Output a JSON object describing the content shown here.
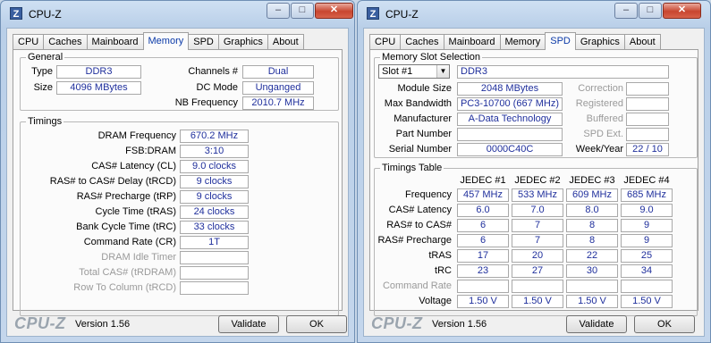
{
  "left_window": {
    "title": "CPU-Z",
    "icon_letter": "Z",
    "tabs": [
      "CPU",
      "Caches",
      "Mainboard",
      "Memory",
      "SPD",
      "Graphics",
      "About"
    ],
    "active_tab": "Memory",
    "general": {
      "label": "General",
      "type_label": "Type",
      "type_value": "DDR3",
      "size_label": "Size",
      "size_value": "4096 MBytes",
      "channels_label": "Channels #",
      "channels_value": "Dual",
      "dcmode_label": "DC Mode",
      "dcmode_value": "Unganged",
      "nbfreq_label": "NB Frequency",
      "nbfreq_value": "2010.7 MHz"
    },
    "timings": {
      "label": "Timings",
      "rows": [
        {
          "label": "DRAM Frequency",
          "value": "670.2 MHz"
        },
        {
          "label": "FSB:DRAM",
          "value": "3:10"
        },
        {
          "label": "CAS# Latency (CL)",
          "value": "9.0 clocks"
        },
        {
          "label": "RAS# to CAS# Delay (tRCD)",
          "value": "9 clocks"
        },
        {
          "label": "RAS# Precharge (tRP)",
          "value": "9 clocks"
        },
        {
          "label": "Cycle Time (tRAS)",
          "value": "24 clocks"
        },
        {
          "label": "Bank Cycle Time (tRC)",
          "value": "33 clocks"
        },
        {
          "label": "Command Rate (CR)",
          "value": "1T"
        },
        {
          "label": "DRAM Idle Timer",
          "value": ""
        },
        {
          "label": "Total CAS# (tRDRAM)",
          "value": ""
        },
        {
          "label": "Row To Column (tRCD)",
          "value": ""
        }
      ]
    },
    "footer": {
      "brand": "CPU-Z",
      "version": "Version 1.56",
      "validate": "Validate",
      "ok": "OK"
    }
  },
  "right_window": {
    "title": "CPU-Z",
    "icon_letter": "Z",
    "tabs": [
      "CPU",
      "Caches",
      "Mainboard",
      "Memory",
      "SPD",
      "Graphics",
      "About"
    ],
    "active_tab": "SPD",
    "slot": {
      "label": "Memory Slot Selection",
      "selected": "Slot #1",
      "type_value": "DDR3",
      "module_size_label": "Module Size",
      "module_size_value": "2048 MBytes",
      "max_bw_label": "Max Bandwidth",
      "max_bw_value": "PC3-10700 (667 MHz)",
      "manufacturer_label": "Manufacturer",
      "manufacturer_value": "A-Data Technology",
      "part_label": "Part Number",
      "part_value": "",
      "serial_label": "Serial Number",
      "serial_value": "0000C40C",
      "correction_label": "Correction",
      "correction_value": "",
      "registered_label": "Registered",
      "registered_value": "",
      "buffered_label": "Buffered",
      "buffered_value": "",
      "spd_ext_label": "SPD Ext.",
      "spd_ext_value": "",
      "weekyear_label": "Week/Year",
      "weekyear_value": "22 / 10"
    },
    "timings_table": {
      "label": "Timings Table",
      "columns": [
        "JEDEC #1",
        "JEDEC #2",
        "JEDEC #3",
        "JEDEC #4"
      ],
      "rows": [
        {
          "label": "Frequency",
          "values": [
            "457 MHz",
            "533 MHz",
            "609 MHz",
            "685 MHz"
          ],
          "dim": false
        },
        {
          "label": "CAS# Latency",
          "values": [
            "6.0",
            "7.0",
            "8.0",
            "9.0"
          ],
          "dim": false
        },
        {
          "label": "RAS# to CAS#",
          "values": [
            "6",
            "7",
            "8",
            "9"
          ],
          "dim": false
        },
        {
          "label": "RAS# Precharge",
          "values": [
            "6",
            "7",
            "8",
            "9"
          ],
          "dim": false
        },
        {
          "label": "tRAS",
          "values": [
            "17",
            "20",
            "22",
            "25"
          ],
          "dim": false
        },
        {
          "label": "tRC",
          "values": [
            "23",
            "27",
            "30",
            "34"
          ],
          "dim": false
        },
        {
          "label": "Command Rate",
          "values": [
            "",
            "",
            "",
            ""
          ],
          "dim": true
        },
        {
          "label": "Voltage",
          "values": [
            "1.50 V",
            "1.50 V",
            "1.50 V",
            "1.50 V"
          ],
          "dim": false
        }
      ]
    },
    "footer": {
      "brand": "CPU-Z",
      "version": "Version 1.56",
      "validate": "Validate",
      "ok": "OK"
    }
  },
  "window_controls": {
    "minimize": "–",
    "maximize": "□",
    "close": "✕"
  }
}
